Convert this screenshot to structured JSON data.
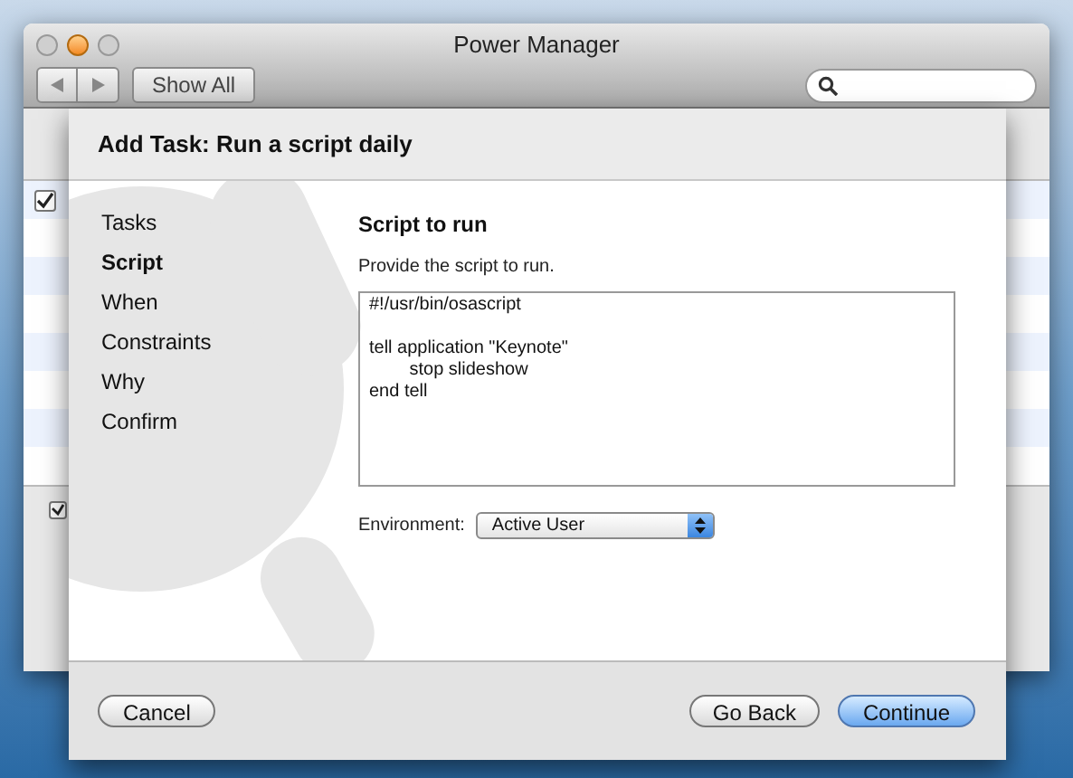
{
  "window": {
    "title": "Power Manager",
    "show_all": "Show All",
    "background_list": {
      "checked": true
    },
    "bottom_checkbox": {
      "checked": true
    }
  },
  "sheet": {
    "title": "Add Task: Run a script daily",
    "steps": [
      {
        "label": "Tasks",
        "selected": false
      },
      {
        "label": "Script",
        "selected": true
      },
      {
        "label": "When",
        "selected": false
      },
      {
        "label": "Constraints",
        "selected": false
      },
      {
        "label": "Why",
        "selected": false
      },
      {
        "label": "Confirm",
        "selected": false
      }
    ],
    "heading": "Script to run",
    "instruction": "Provide the script to run.",
    "script": "#!/usr/bin/osascript\n\ntell application \"Keynote\"\n\tstop slideshow\nend tell",
    "environment_label": "Environment:",
    "environment": "Active User",
    "buttons": {
      "cancel": "Cancel",
      "back": "Go Back",
      "continue": "Continue"
    }
  }
}
